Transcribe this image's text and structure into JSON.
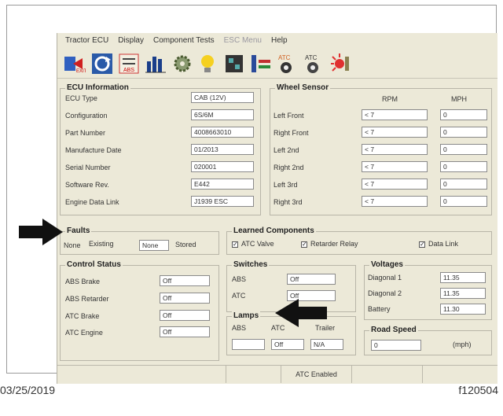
{
  "menu": [
    "Tractor ECU",
    "Display",
    "Component Tests",
    "ESC Menu",
    "Help"
  ],
  "ecu": {
    "title": "ECU Information",
    "rows": [
      {
        "label": "ECU Type",
        "value": "CAB (12V)"
      },
      {
        "label": "Configuration",
        "value": "6S/6M"
      },
      {
        "label": "Part Number",
        "value": "4008663010"
      },
      {
        "label": "Manufacture Date",
        "value": "01/2013"
      },
      {
        "label": "Serial Number",
        "value": "020001"
      },
      {
        "label": "Software Rev.",
        "value": "E442"
      },
      {
        "label": "Engine Data Link",
        "value": "J1939 ESC"
      }
    ]
  },
  "wheel": {
    "title": "Wheel Sensor",
    "col_rpm": "RPM",
    "col_mph": "MPH",
    "rows": [
      {
        "label": "Left Front",
        "rpm": "< 7",
        "mph": "0"
      },
      {
        "label": "Right Front",
        "rpm": "< 7",
        "mph": "0"
      },
      {
        "label": "Left 2nd",
        "rpm": "< 7",
        "mph": "0"
      },
      {
        "label": "Right 2nd",
        "rpm": "< 7",
        "mph": "0"
      },
      {
        "label": "Left 3rd",
        "rpm": "< 7",
        "mph": "0"
      },
      {
        "label": "Right 3rd",
        "rpm": "< 7",
        "mph": "0"
      }
    ]
  },
  "faults": {
    "title": "Faults",
    "existing_value": "None",
    "existing_label": "Existing",
    "stored_value": "None",
    "stored_label": "Stored"
  },
  "learned": {
    "title": "Learned Components",
    "items": [
      "ATC Valve",
      "Retarder Relay",
      "Data Link"
    ]
  },
  "control": {
    "title": "Control Status",
    "rows": [
      {
        "label": "ABS Brake",
        "value": "Off"
      },
      {
        "label": "ABS Retarder",
        "value": "Off"
      },
      {
        "label": "ATC Brake",
        "value": "Off"
      },
      {
        "label": "ATC Engine",
        "value": "Off"
      }
    ]
  },
  "switches": {
    "title": "Switches",
    "rows": [
      {
        "label": "ABS",
        "value": "Off"
      },
      {
        "label": "ATC",
        "value": "Off"
      }
    ]
  },
  "lamps": {
    "title": "Lamps",
    "labels": [
      "ABS",
      "ATC",
      "Trailer"
    ],
    "values": [
      "",
      "Off",
      "N/A"
    ]
  },
  "voltages": {
    "title": "Voltages",
    "rows": [
      {
        "label": "Diagonal 1",
        "value": "11.35"
      },
      {
        "label": "Diagonal 2",
        "value": "11.35"
      },
      {
        "label": "Battery",
        "value": "11.30"
      }
    ]
  },
  "speed": {
    "title": "Road Speed",
    "value": "0",
    "unit": "(mph)"
  },
  "status": {
    "atc": "ATC Enabled"
  },
  "footer": {
    "date": "03/25/2019",
    "code": "f120504"
  },
  "colors": {
    "window_bg": "#ece9d8",
    "arrow": "#111111"
  }
}
